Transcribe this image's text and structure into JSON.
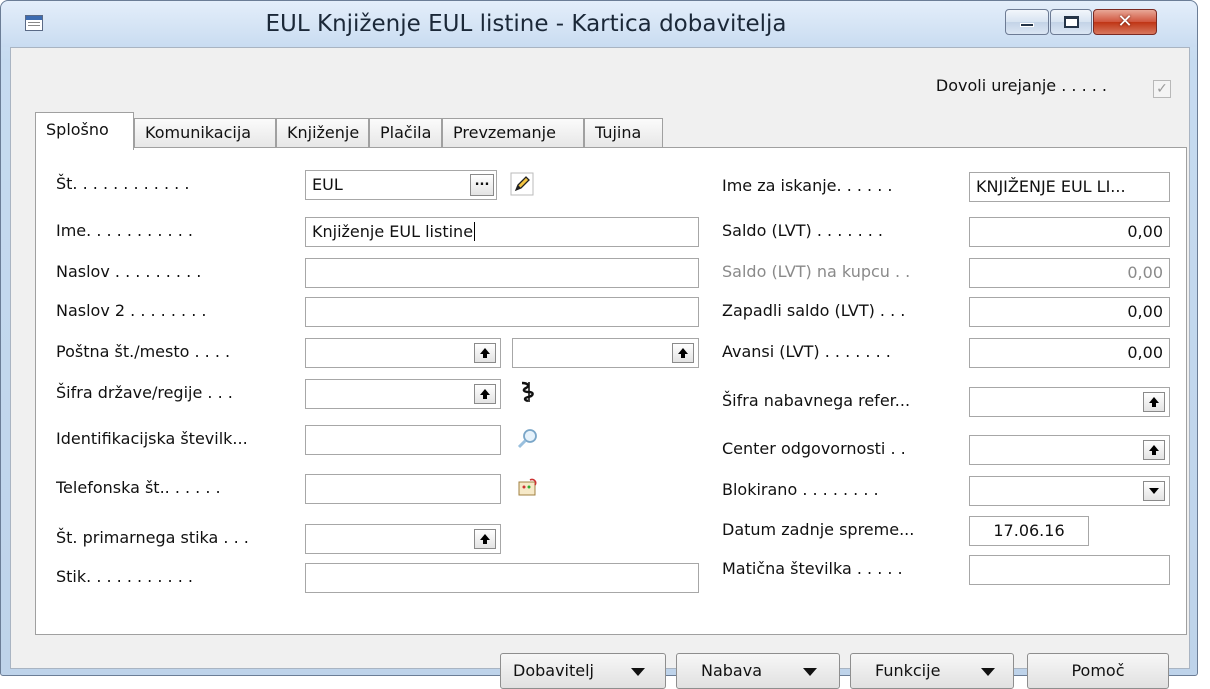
{
  "window": {
    "title": "EUL Knjiženje EUL listine - Kartica dobavitelja",
    "controls": {
      "close": "✕"
    }
  },
  "permission": {
    "label": "Dovoli urejanje . . . . .",
    "checked": true,
    "check_glyph": "✓"
  },
  "tabs": [
    "Splošno",
    "Komunikacija",
    "Knjiženje",
    "Plačila",
    "Prevzemanje",
    "Tujina"
  ],
  "left": {
    "no": {
      "label": "Št. . . . . . . . . . . .",
      "value": "EUL",
      "ellipsis": "..."
    },
    "name": {
      "label": "Ime. . . . . . . . . . .",
      "value": "Knjiženje EUL listine"
    },
    "address": {
      "label": "Naslov . . . . . . . . .",
      "value": ""
    },
    "address2": {
      "label": "Naslov 2 . . . . . . . .",
      "value": ""
    },
    "post": {
      "label": "Poštna št./mesto . . . .",
      "value": "",
      "city": ""
    },
    "country": {
      "label": "Šifra države/regije . . .",
      "value": ""
    },
    "vat": {
      "label": "Identifikacijska številk...",
      "value": ""
    },
    "phone": {
      "label": "Telefonska št.. . . . . .",
      "value": ""
    },
    "primary_contact": {
      "label": "Št. primarnega stika . . .",
      "value": ""
    },
    "contact": {
      "label": "Stik. . . . . . . . . . .",
      "value": ""
    }
  },
  "right": {
    "search_name": {
      "label": "Ime za iskanje. . . . . .",
      "value": "KNJIŽENJE EUL LI..."
    },
    "balance": {
      "label": "Saldo (LVT) . . . . . . .",
      "value": "0,00"
    },
    "balance_customer": {
      "label": "Saldo (LVT) na kupcu . .",
      "value": "0,00"
    },
    "balance_due": {
      "label": "Zapadli saldo (LVT) . . .",
      "value": "0,00"
    },
    "prepayments": {
      "label": "Avansi (LVT) . . . . . . .",
      "value": "0,00"
    },
    "purchaser": {
      "label": "Šifra nabavnega refer...",
      "value": ""
    },
    "resp_center": {
      "label": "Center odgovornosti . .",
      "value": ""
    },
    "blocked": {
      "label": "Blokirano . . . . . . . .",
      "value": ""
    },
    "last_modified": {
      "label": "Datum zadnje spreme...",
      "value": "17.06.16"
    },
    "reg_no": {
      "label": "Matična številka . . . . .",
      "value": ""
    }
  },
  "buttons": {
    "vendor": "Dobavitelj",
    "purchase": "Nabava",
    "functions": "Funkcije",
    "help": "Pomoč"
  },
  "colors": {
    "window_frame": "#c6dbf0",
    "close": "#c8452a"
  }
}
